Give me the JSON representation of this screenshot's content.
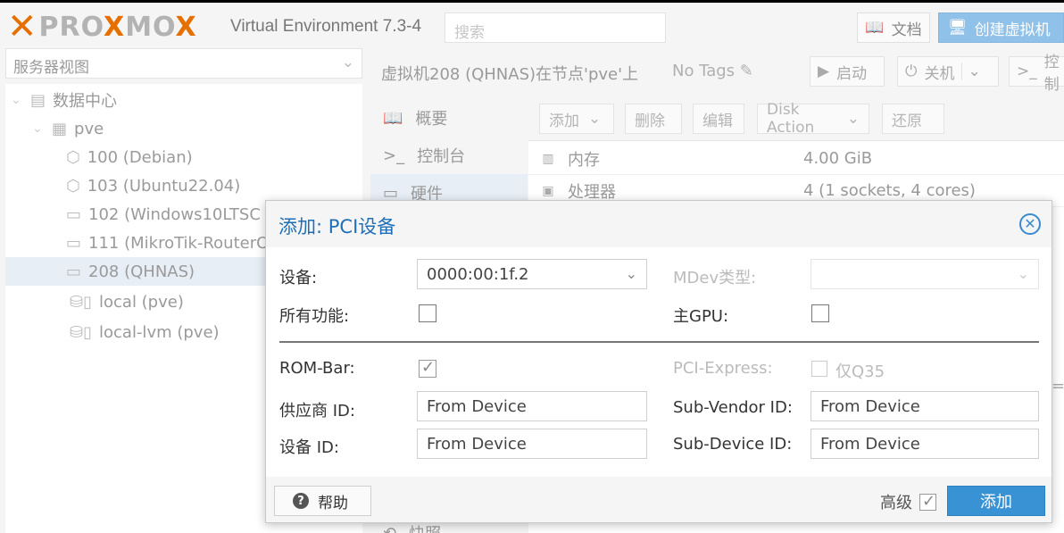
{
  "header": {
    "logo_text": "PROXMOX",
    "product": "Virtual Environment 7.3-4",
    "search_placeholder": "搜索",
    "docs_label": "文档",
    "create_vm_label": "创建虚拟机"
  },
  "sidebar": {
    "view_selector": "服务器视图",
    "tree": [
      {
        "label": "数据中心"
      },
      {
        "label": "pve"
      },
      {
        "label": "100 (Debian)"
      },
      {
        "label": "103 (Ubuntu22.04)"
      },
      {
        "label": "102 (Windows10LTSC"
      },
      {
        "label": "111 (MikroTik-RouterO"
      },
      {
        "label": "208 (QHNAS)"
      },
      {
        "label": "local (pve)"
      },
      {
        "label": "local-lvm (pve)"
      }
    ]
  },
  "content": {
    "title": "虚拟机208 (QHNAS)在节点'pve'上",
    "tags": "No Tags",
    "start_label": "启动",
    "shutdown_label": "关机",
    "console_label": "控制"
  },
  "vm_menu": [
    {
      "label": "概要"
    },
    {
      "label": "控制台"
    },
    {
      "label": "硬件"
    },
    {
      "label": "快照"
    }
  ],
  "hardware": {
    "toolbar": {
      "add": "添加",
      "remove": "删除",
      "edit": "编辑",
      "disk_action": "Disk Action",
      "revert": "还原"
    },
    "rows": [
      {
        "name": "内存",
        "value": "4.00 GiB"
      },
      {
        "name": "处理器",
        "value": "4 (1 sockets, 4 cores)"
      }
    ],
    "clipped_text": "=v"
  },
  "dialog": {
    "title": "添加: PCI设备",
    "device_label": "设备:",
    "device_value": "0000:00:1f.2",
    "mdev_label": "MDev类型:",
    "all_functions_label": "所有功能:",
    "all_functions_checked": false,
    "primary_gpu_label": "主GPU:",
    "primary_gpu_checked": false,
    "rombar_label": "ROM-Bar:",
    "rombar_checked": true,
    "pcie_label": "PCI-Express:",
    "pcie_option": "仅Q35",
    "vendor_id_label": "供应商 ID:",
    "vendor_id_placeholder": "From Device",
    "subvendor_id_label": "Sub-Vendor ID:",
    "subvendor_id_placeholder": "From Device",
    "device_id_label": "设备 ID:",
    "device_id_placeholder": "From Device",
    "subdevice_id_label": "Sub-Device ID:",
    "subdevice_id_placeholder": "From Device",
    "help_label": "帮助",
    "advanced_label": "高级",
    "advanced_checked": true,
    "add_label": "添加"
  }
}
